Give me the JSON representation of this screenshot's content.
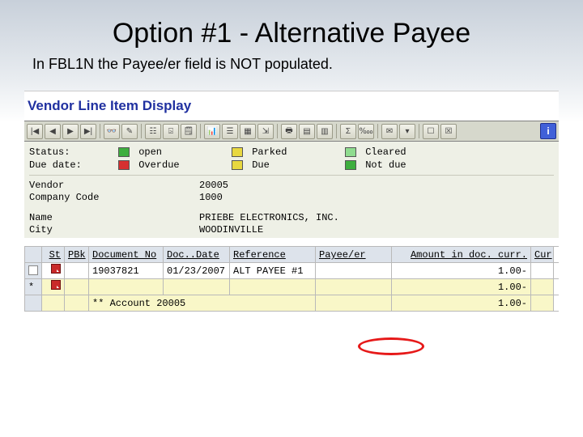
{
  "slide": {
    "title": "Option #1 - Alternative Payee",
    "subtitle": "In FBL1N the Payee/er field is NOT populated."
  },
  "screen": {
    "title": "Vendor Line Item Display"
  },
  "status": {
    "status_label": "Status:",
    "due_label": "Due date:",
    "open": "open",
    "overdue": "Overdue",
    "parked": "Parked",
    "due": "Due",
    "cleared": "Cleared",
    "notdue": "Not due"
  },
  "kv": {
    "vendor_label": "Vendor",
    "vendor_val": "20005",
    "cc_label": "Company Code",
    "cc_val": "1000",
    "name_label": "Name",
    "name_val": "PRIEBE ELECTRONICS, INC.",
    "city_label": "City",
    "city_val": "WOODINVILLE"
  },
  "grid": {
    "headers": {
      "st": "St",
      "pbk": "PBk",
      "doc": "Document No",
      "date": "Doc..Date",
      "ref": "Reference",
      "payee": "Payee/er",
      "amt": "Amount in doc. curr.",
      "cur": "Cur"
    },
    "row1": {
      "doc": "19037821",
      "date": "01/23/2007",
      "ref": "ALT PAYEE #1",
      "payee": "",
      "amt": "1.00-"
    },
    "row2": {
      "star": "*",
      "amt": "1.00-"
    },
    "row3": {
      "label": "** Account 20005",
      "amt": "1.00-"
    }
  }
}
